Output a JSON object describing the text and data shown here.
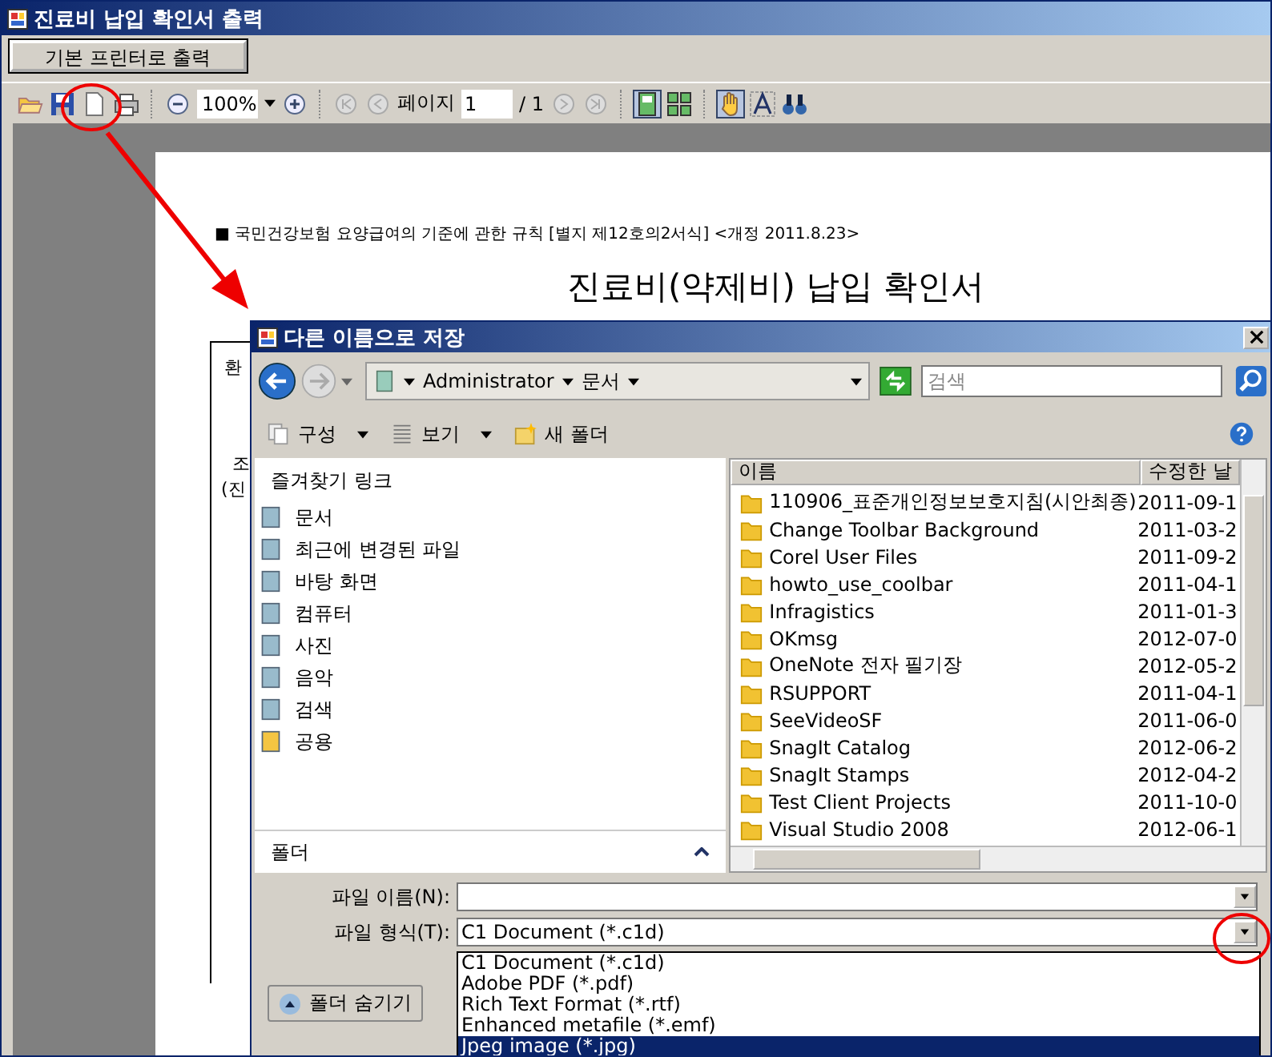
{
  "window": {
    "title": "진료비 납입 확인서 출력"
  },
  "print_button": "기본 프린터로 출력",
  "toolbar": {
    "zoom": "100%",
    "page_label": "페이지",
    "page_value": "1",
    "page_total": "/ 1"
  },
  "document": {
    "header": "■ 국민건강보험 요양급여의 기준에 관한 규칙 [별지 제12호의2서식] <개정 2011.8.23>",
    "title": "진료비(약제비) 납입 확인서",
    "fragments": [
      "환",
      "조",
      "(진"
    ]
  },
  "dialog": {
    "title": "다른 이름으로 저장",
    "breadcrumb": [
      "Administrator",
      "문서"
    ],
    "search": {
      "placeholder": "검색"
    },
    "commands": [
      "구성",
      "보기",
      "새 폴더"
    ],
    "favorites_title": "즐겨찾기 링크",
    "favorites": [
      {
        "label": "문서"
      },
      {
        "label": "최근에 변경된 파일"
      },
      {
        "label": "바탕 화면"
      },
      {
        "label": "컴퓨터"
      },
      {
        "label": "사진"
      },
      {
        "label": "음악"
      },
      {
        "label": "검색"
      },
      {
        "label": "공용"
      }
    ],
    "folder_toggle": "폴더",
    "columns": [
      "이름",
      "수정한 날"
    ],
    "files": [
      {
        "name": "110906_표준개인정보보호지침(시안최종)",
        "date": "2011-09-1"
      },
      {
        "name": "Change Toolbar Background",
        "date": "2011-03-2"
      },
      {
        "name": "Corel User Files",
        "date": "2011-09-2"
      },
      {
        "name": "howto_use_coolbar",
        "date": "2011-04-1"
      },
      {
        "name": "Infragistics",
        "date": "2011-01-3"
      },
      {
        "name": "OKmsg",
        "date": "2012-07-0"
      },
      {
        "name": "OneNote 전자 필기장",
        "date": "2012-05-2"
      },
      {
        "name": "RSUPPORT",
        "date": "2011-04-1"
      },
      {
        "name": "SeeVideoSF",
        "date": "2011-06-0"
      },
      {
        "name": "SnagIt Catalog",
        "date": "2012-06-2"
      },
      {
        "name": "SnagIt Stamps",
        "date": "2012-04-2"
      },
      {
        "name": "Test Client Projects",
        "date": "2011-10-0"
      },
      {
        "name": "Visual Studio 2008",
        "date": "2012-06-1"
      }
    ],
    "filename_label": "파일 이름(N):",
    "filetype_label": "파일 형식(T):",
    "filetype_value": "C1 Document (*.c1d)",
    "filetype_options": [
      {
        "label": "C1 Document (*.c1d)",
        "selected": false
      },
      {
        "label": "Adobe PDF (*.pdf)",
        "selected": false
      },
      {
        "label": "Rich Text Format (*.rtf)",
        "selected": false
      },
      {
        "label": "Enhanced metafile (*.emf)",
        "selected": false
      },
      {
        "label": "Jpeg image (*.jpg)",
        "selected": true
      }
    ],
    "hide_folders": "폴더 숨기기"
  }
}
